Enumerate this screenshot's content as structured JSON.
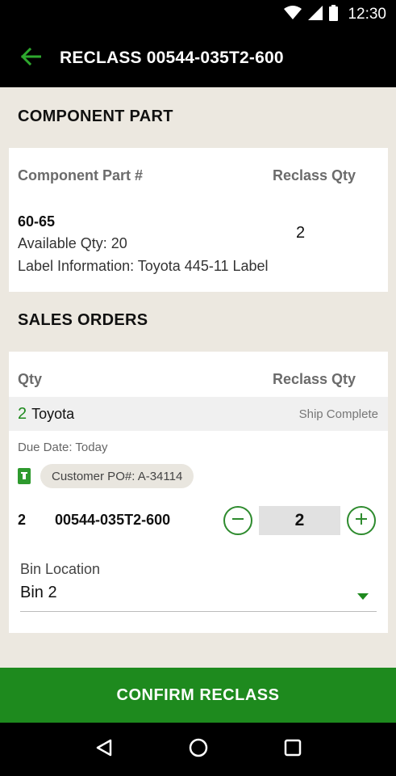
{
  "status_bar": {
    "time": "12:30"
  },
  "app_bar": {
    "title": "RECLASS 00544-035T2-600"
  },
  "component_section": {
    "title": "COMPONENT PART",
    "col_part": "Component Part #",
    "col_qty": "Reclass Qty",
    "part_number": "60-65",
    "available_qty": "Available Qty: 20",
    "label_info": "Label Information: Toyota 445-11 Label",
    "reclass_qty": "2"
  },
  "sales_section": {
    "title": "SALES ORDERS",
    "col_qty": "Qty",
    "col_reclass": "Reclass Qty",
    "order": {
      "qty": "2",
      "customer": "Toyota",
      "status": "Ship Complete",
      "due_date": "Due Date: Today",
      "customer_po": "Customer PO#: A-34114",
      "line_qty": "2",
      "line_part": "00544-035T2-600",
      "reclass_value": "2"
    },
    "bin": {
      "label": "Bin Location",
      "value": "Bin 2"
    }
  },
  "confirm_label": "CONFIRM RECLASS",
  "colors": {
    "accent_green": "#1E8A1E",
    "background": "#ECE8E0"
  },
  "icons": [
    "wifi-icon",
    "signal-icon",
    "battery-icon",
    "back-arrow-icon",
    "document-icon",
    "minus-icon",
    "plus-icon",
    "dropdown-icon",
    "nav-back-icon",
    "nav-home-icon",
    "nav-recents-icon"
  ]
}
